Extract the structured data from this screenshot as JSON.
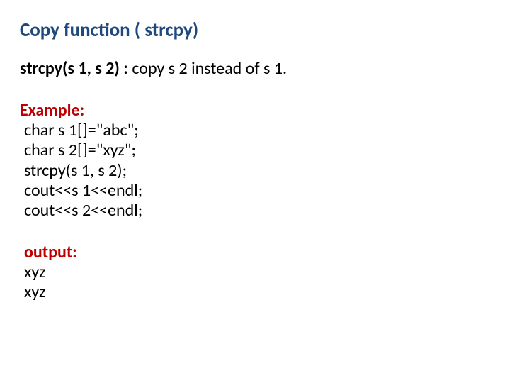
{
  "title": "Copy function ( strcpy)",
  "sig_bold": "strcpy(s 1, s 2) :",
  "sig_desc": " copy s 2 instead of s 1.",
  "example_label": "Example:",
  "code": {
    "l1": "char s 1[]=\"abc\";",
    "l2": "char s 2[]=\"xyz\";",
    "l3": "strcpy(s 1, s 2);",
    "l4": "cout<<s 1<<endl;",
    "l5": "cout<<s 2<<endl;"
  },
  "output_label": "output:",
  "output": {
    "l1": "xyz",
    "l2": "xyz"
  }
}
